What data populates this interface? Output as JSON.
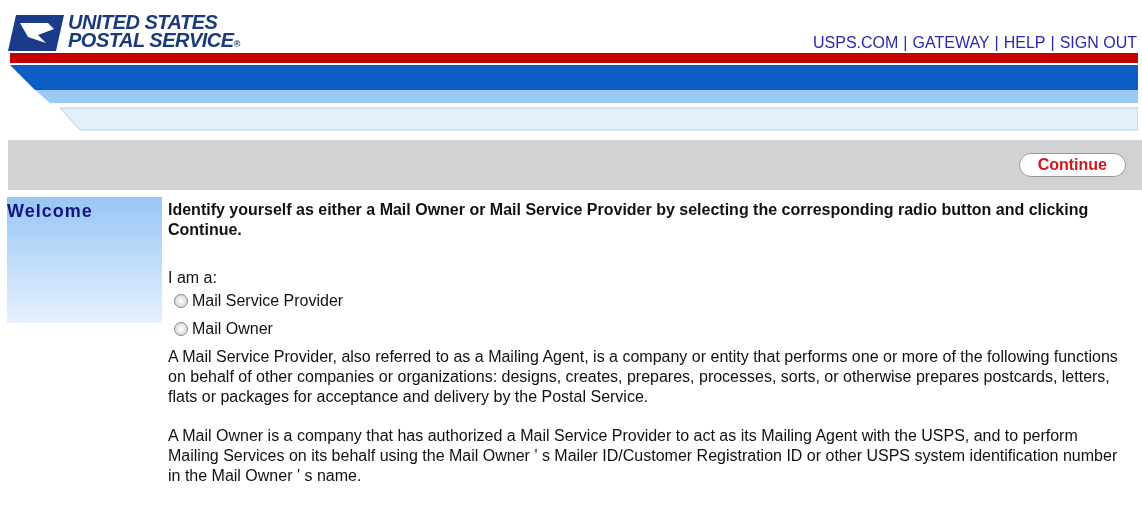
{
  "logo": {
    "line_1": "UNITED STATES",
    "line_2": "POSTAL SERVICE",
    "mark": "®"
  },
  "top_links": [
    {
      "label": "USPS.COM"
    },
    {
      "label": "GATEWAY"
    },
    {
      "label": "HELP"
    },
    {
      "label": "SIGN OUT"
    }
  ],
  "link_separator": "|",
  "toolbar": {
    "button": "Continue"
  },
  "sidebar": {
    "title": "Welcome"
  },
  "content": {
    "instruction": "Identify yourself as either a Mail Owner or Mail Service Provider by selecting the corresponding radio button and clicking Continue.",
    "prompt": "I am a:",
    "options": [
      {
        "label": "Mail Service Provider",
        "selected": false
      },
      {
        "label": "Mail Owner",
        "selected": false
      }
    ],
    "paragraphs": [
      "A Mail Service Provider, also referred to as a Mailing Agent, is a company or entity that performs one or more of the following functions on behalf of other companies or organizations: designs, creates, prepares, processes, sorts, or otherwise prepares postcards, letters, flats or packages for acceptance and delivery by the Postal Service.",
      "A Mail Owner is a company that has authorized a Mail Service Provider to act as its Mailing Agent with the USPS, and to perform Mailing Services on its behalf using the Mail Owner ' s Mailer ID/Customer Registration ID or other USPS system identification number in the Mail Owner ' s name."
    ]
  }
}
